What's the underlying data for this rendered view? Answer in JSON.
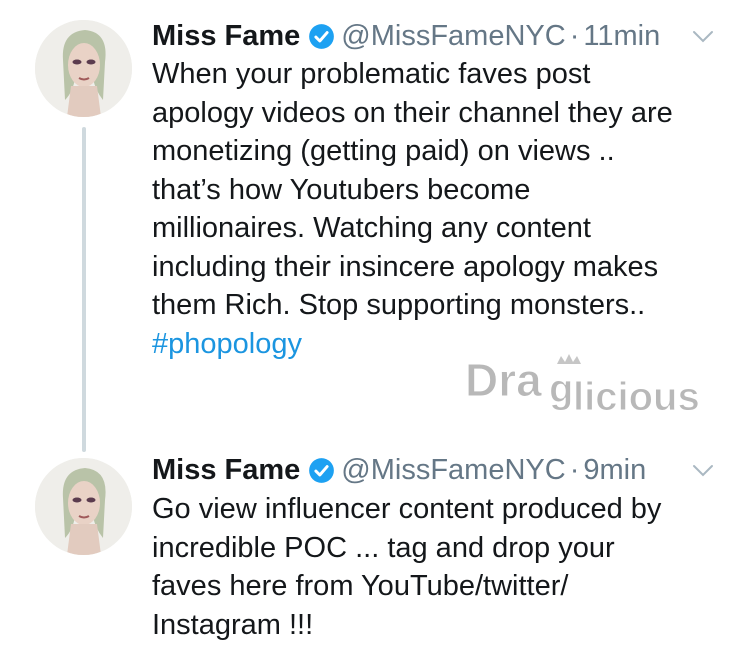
{
  "tweets": [
    {
      "author": {
        "name": "Miss Fame",
        "handle": "@MissFameNYC"
      },
      "separator": "·",
      "time": "11min",
      "lines": [
        "When your problematic faves post",
        "apology videos on their channel they  are",
        "monetizing (getting paid) on views ..",
        "that’s how Youtubers become",
        "millionaires. Watching any content",
        "including their insincere apology makes",
        "them Rich. Stop supporting monsters.."
      ],
      "hashtag": "#phopology"
    },
    {
      "author": {
        "name": "Miss Fame",
        "handle": "@MissFameNYC"
      },
      "separator": "·",
      "time": "9min",
      "lines": [
        "Go view influencer content produced by",
        "incredible POC ... tag and drop your",
        "faves here from YouTube/twitter/",
        "Instagram !!!"
      ]
    }
  ],
  "watermark": {
    "text_start": "Dra",
    "text_g": "g",
    "text_end": "licious"
  },
  "colors": {
    "text": "#14171a",
    "muted": "#657786",
    "link": "#1b95e0",
    "verified": "#1da1f2",
    "thread_line": "#cfd9de"
  },
  "icons": [
    "avatar",
    "verified-badge-icon",
    "chevron-down-icon"
  ]
}
